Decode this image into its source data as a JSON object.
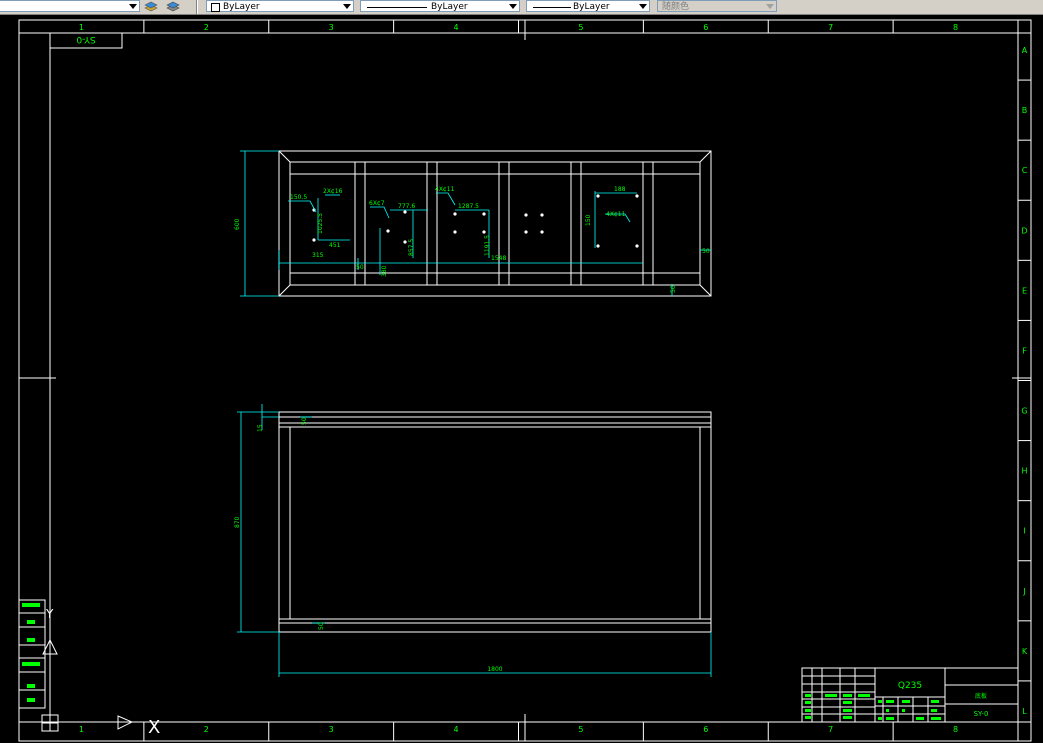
{
  "toolbar": {
    "color_control": "ByLayer",
    "linetype_control": "ByLayer",
    "lineweight_control": "ByLayer",
    "plotstyle_control": "随颜色"
  },
  "colors": {
    "background": "#000000",
    "frame": "#ffffff",
    "dimension": "#00ffff",
    "annotation_text": "#00ff00"
  },
  "border": {
    "columns": [
      "1",
      "2",
      "3",
      "4",
      "5",
      "6",
      "7",
      "8"
    ],
    "rows": [
      "A",
      "B",
      "C",
      "D",
      "E",
      "F",
      "G",
      "H",
      "I",
      "J",
      "K",
      "L"
    ],
    "corner_stamp": "SY-0"
  },
  "top_view": {
    "dimensions": [
      "315",
      "150.5",
      "2X¢16",
      "1025.5",
      "451",
      "380",
      "6X¢7",
      "777.6",
      "857.5",
      "4X¢11",
      "1287.5",
      "1191.5",
      "1548",
      "50",
      "188",
      "150",
      "4X¢11",
      "50",
      "50",
      "600"
    ]
  },
  "front_view": {
    "dimensions": [
      "15",
      "50",
      "870",
      "50",
      "1800"
    ]
  },
  "title_block": {
    "material": "Q235",
    "drawing_number": "SY-0",
    "drawing_name": "底板"
  },
  "ucs_icon": {
    "x_axis": "X",
    "y_axis": "Y"
  }
}
